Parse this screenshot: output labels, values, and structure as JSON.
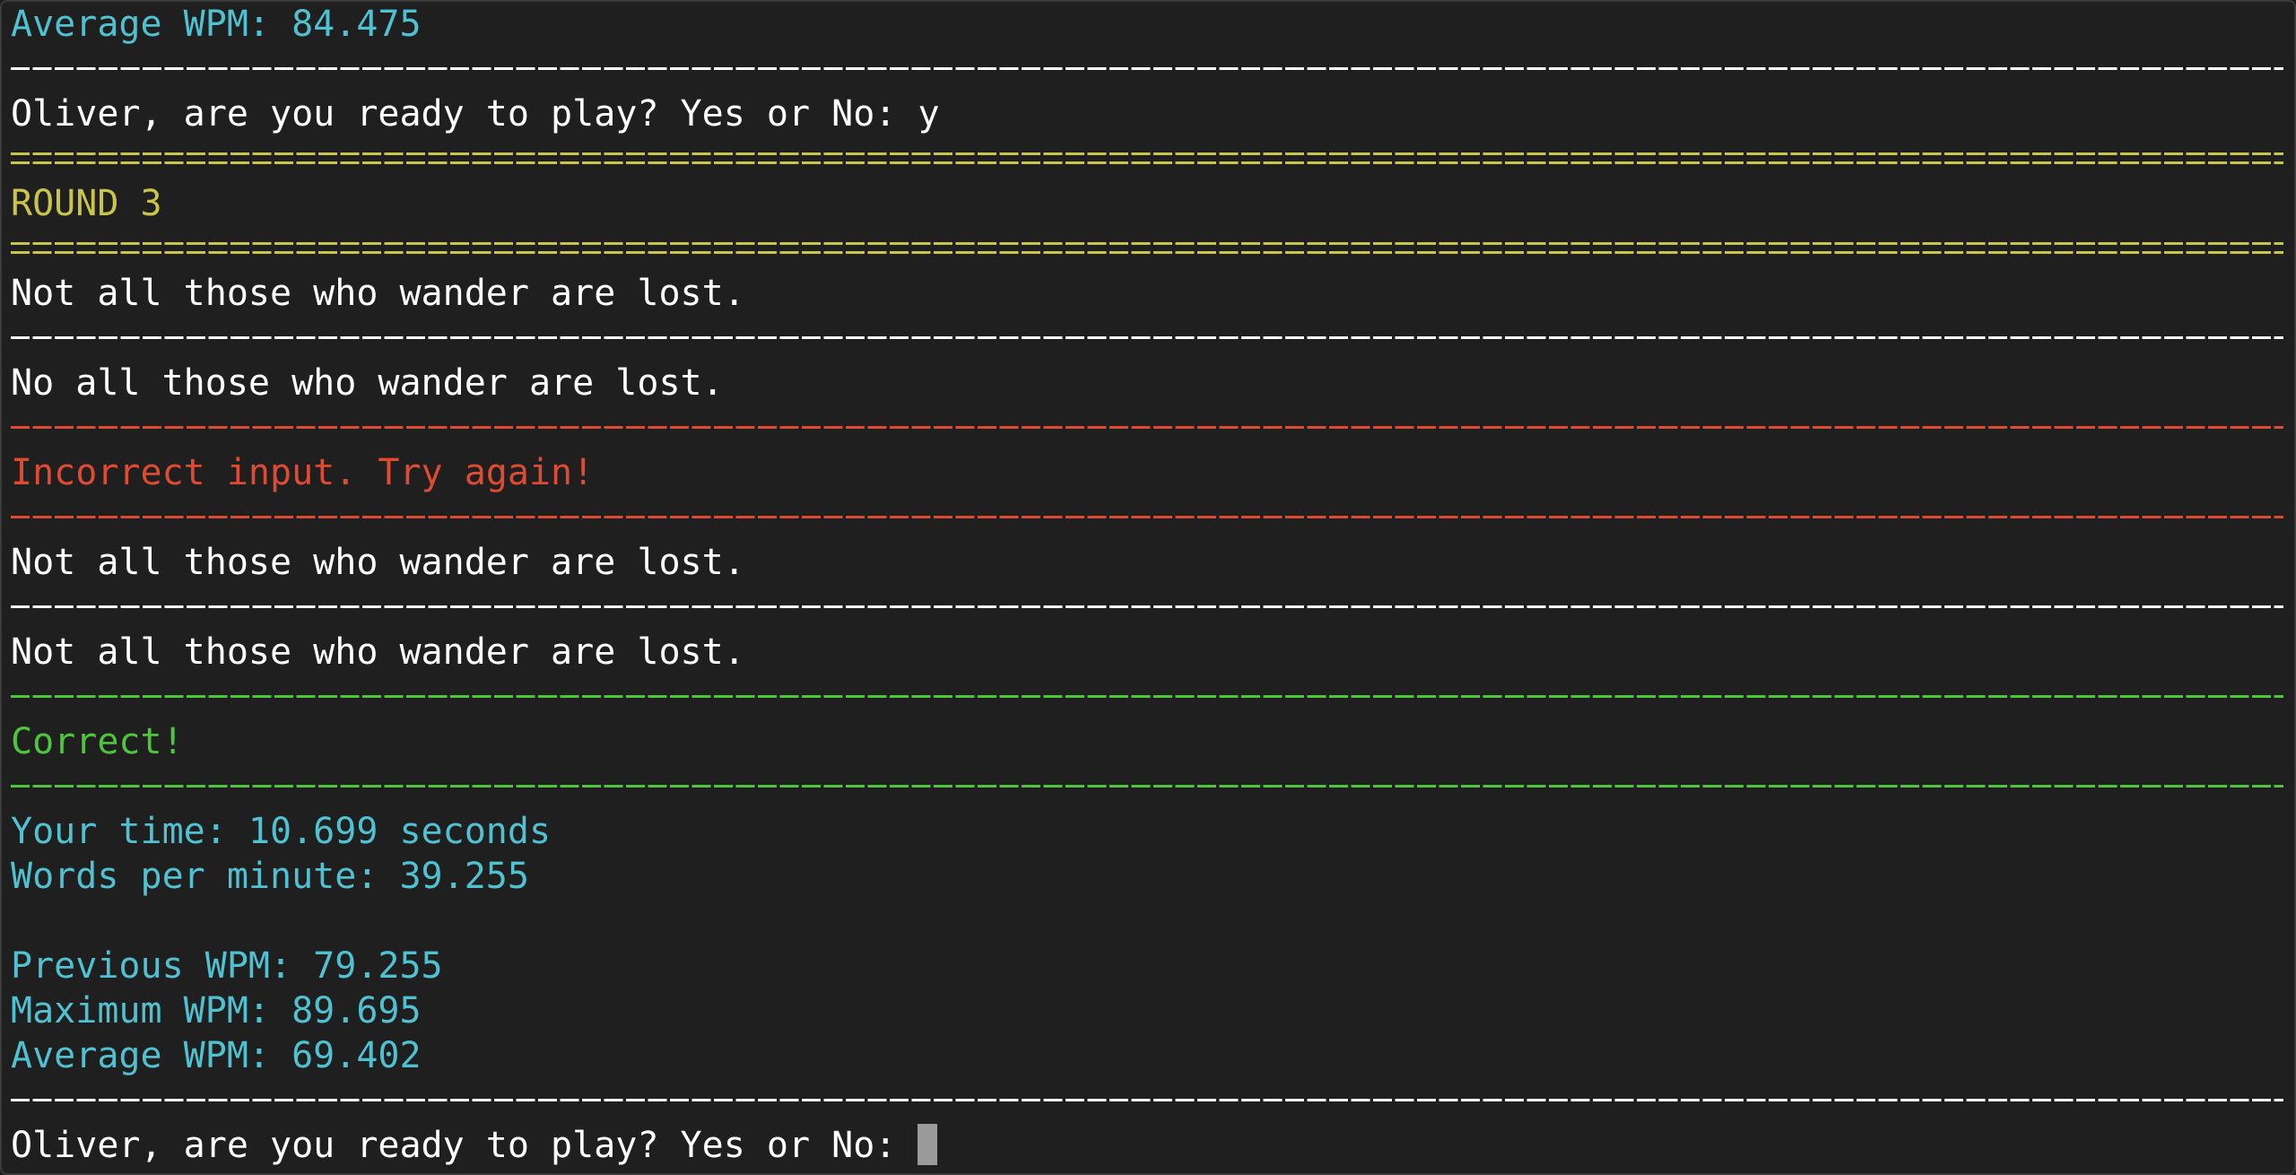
{
  "terminal": {
    "colors": {
      "background": "#1f1f1f",
      "text": "#ffffff",
      "stats": "#4fc1d1",
      "round": "#c9c44a",
      "error": "#df4a33",
      "success": "#4ec63c",
      "cursor": "#9a9a9a"
    },
    "previous_average": "Average WPM: 84.475",
    "ready_prompt_answered": "Oliver, are you ready to play? Yes or No: y",
    "round_title": "ROUND 3",
    "attempt_1": {
      "target": "Not all those who wander are lost.",
      "typed": "No all those who wander are lost.",
      "result": "Incorrect input. Try again!"
    },
    "attempt_2": {
      "target": "Not all those who wander are lost.",
      "typed": "Not all those who wander are lost.",
      "result": "Correct!"
    },
    "stats": {
      "time": "Your time: 10.699 seconds",
      "wpm": "Words per minute: 39.255",
      "previous": "Previous WPM: 79.255",
      "maximum": "Maximum WPM: 89.695",
      "average": "Average WPM: 69.402"
    },
    "ready_prompt": "Oliver, are you ready to play? Yes or No:"
  }
}
